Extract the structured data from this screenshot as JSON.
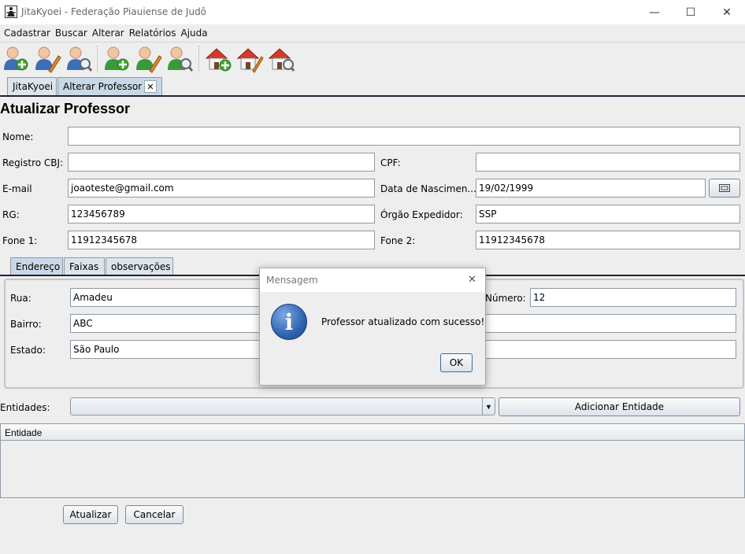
{
  "window": {
    "title": "JitaKyoei - Federação Piauiense de Judô",
    "minimize": "—",
    "maximize": "☐",
    "close": "✕"
  },
  "menu": [
    "Cadastrar",
    "Buscar",
    "Alterar",
    "Relatórios",
    "Ajuda"
  ],
  "toolbar": {
    "icons": [
      "add-person-icon",
      "edit-person-icon",
      "search-person-icon",
      "add-professor-icon",
      "edit-professor-icon",
      "search-professor-icon",
      "add-house-icon",
      "edit-house-icon",
      "search-house-icon"
    ]
  },
  "tabs": [
    {
      "label": "JitaKyoei"
    },
    {
      "label": "Alterar Professor",
      "close": "✕"
    }
  ],
  "form": {
    "heading": "Atualizar Professor",
    "nome_label": "Nome:",
    "nome_value": "",
    "cbj_label": "Registro CBJ:",
    "cbj_value": "",
    "cpf_label": "CPF:",
    "cpf_value": "",
    "email_label": "E-mail",
    "email_value": "joaoteste@gmail.com",
    "nasc_label": "Data de Nascimen...",
    "nasc_value": "19/02/1999",
    "rg_label": "RG:",
    "rg_value": "123456789",
    "orgao_label": "Órgão Expedidor:",
    "orgao_value": "SSP",
    "fone1_label": "Fone 1:",
    "fone1_value": "11912345678",
    "fone2_label": "Fone 2:",
    "fone2_value": "11912345678"
  },
  "subtabs": [
    "Endereço",
    "Faixas",
    "observações"
  ],
  "address": {
    "rua_label": "Rua:",
    "rua_value": "Amadeu",
    "numero_label": "Número:",
    "numero_value": "12",
    "bairro_label": "Bairro:",
    "bairro_value": "ABC",
    "estado_label": "Estado:",
    "estado_value": "São Paulo"
  },
  "entidades": {
    "label": "Entidades:",
    "selected": "",
    "add_button": "Adicionar Entidade",
    "table_header": "Entidade"
  },
  "actions": {
    "update": "Atualizar",
    "cancel": "Cancelar"
  },
  "dialog": {
    "title": "Mensagem",
    "close": "✕",
    "message": "Professor atualizado com sucesso!",
    "ok": "OK",
    "icon_glyph": "i"
  },
  "colors": {
    "accent": "#2b5fa8",
    "dialog_icon": "#2f64b2",
    "border": "#8e9aa6"
  }
}
